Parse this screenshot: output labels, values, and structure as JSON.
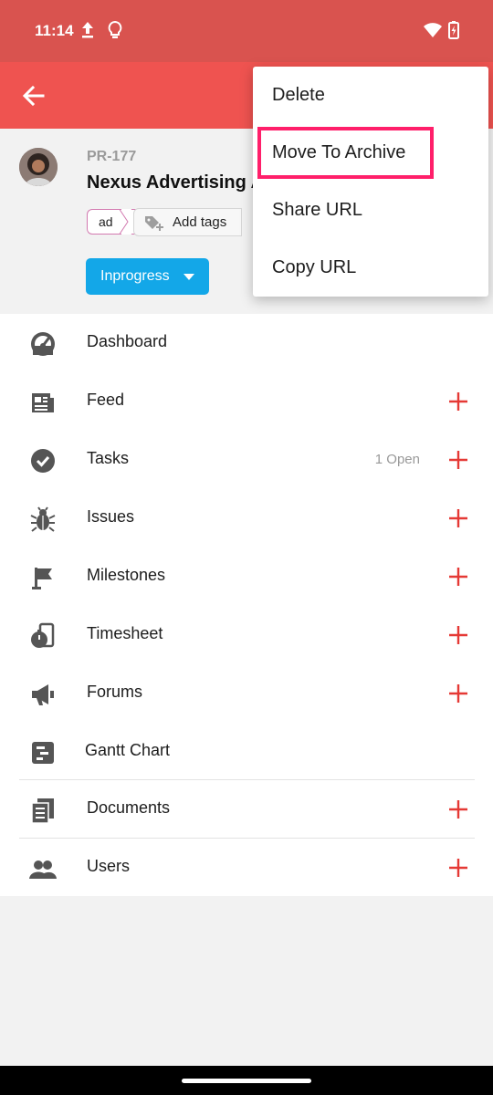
{
  "status_bar": {
    "time": "11:14"
  },
  "project": {
    "id": "PR-177",
    "title": "Nexus Advertising A",
    "tag": "ad",
    "add_tags_label": "Add tags",
    "status_label": "Inprogress"
  },
  "modules": [
    {
      "label": "Dashboard",
      "icon": "speedometer-icon",
      "count": "",
      "addable": false
    },
    {
      "label": "Feed",
      "icon": "newspaper-icon",
      "count": "",
      "addable": true
    },
    {
      "label": "Tasks",
      "icon": "check-circle-icon",
      "count": "1 Open",
      "addable": true
    },
    {
      "label": "Issues",
      "icon": "bug-icon",
      "count": "",
      "addable": true
    },
    {
      "label": "Milestones",
      "icon": "flag-icon",
      "count": "",
      "addable": true
    },
    {
      "label": "Timesheet",
      "icon": "stopwatch-icon",
      "count": "",
      "addable": true
    },
    {
      "label": "Forums",
      "icon": "megaphone-icon",
      "count": "",
      "addable": true
    },
    {
      "label": "Gantt Chart",
      "icon": "gantt-icon",
      "count": "",
      "addable": false
    },
    {
      "label": "Documents",
      "icon": "documents-icon",
      "count": "",
      "addable": true
    },
    {
      "label": "Users",
      "icon": "users-icon",
      "count": "",
      "addable": true
    }
  ],
  "overflow_menu": {
    "items": [
      "Delete",
      "Move To Archive",
      "Share URL",
      "Copy URL"
    ],
    "highlighted": "Move To Archive"
  },
  "colors": {
    "status_bar": "#d9534f",
    "app_bar": "#ef5350",
    "status_button": "#13a7e8",
    "plus": "#e53935",
    "highlight_box": "#ff1f6a"
  }
}
